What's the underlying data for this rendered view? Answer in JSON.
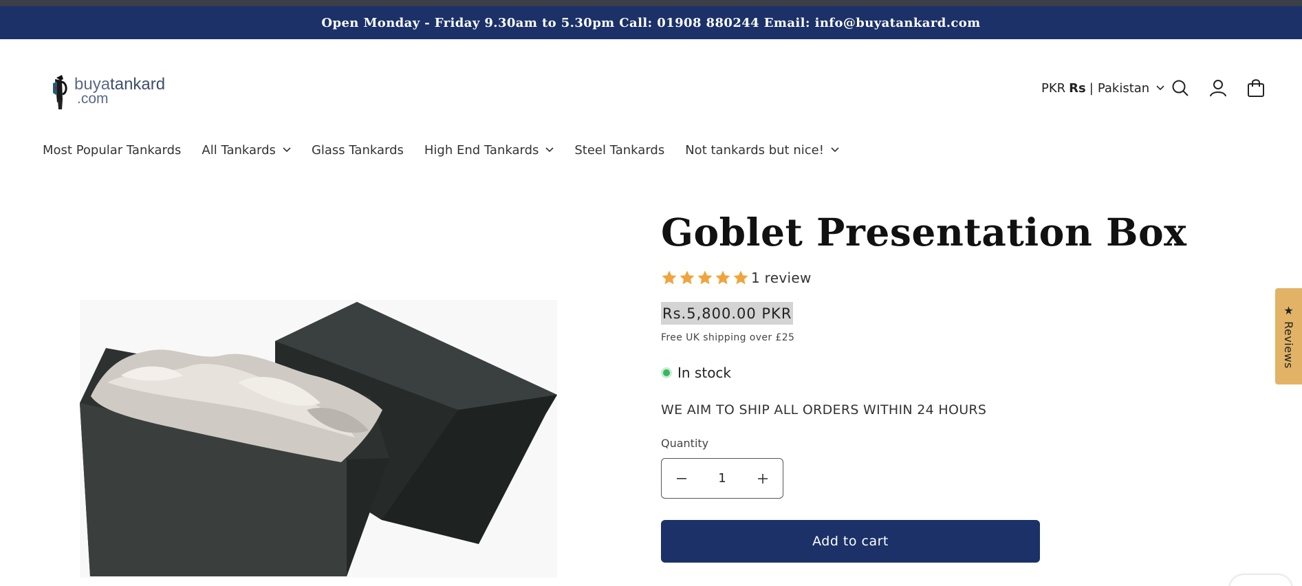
{
  "announcement": {
    "text": "Open Monday - Friday 9.30am to 5.30pm Call: 01908 880244 Email: info@buyatankard.com"
  },
  "logo": {
    "line1_a": "buya",
    "line1_b": "tankard",
    "line2": ".com"
  },
  "header": {
    "currency_code": "PKR",
    "currency_symbol": "Rs",
    "separator": "|",
    "country": "Pakistan"
  },
  "nav": {
    "items": [
      {
        "label": "Most Popular Tankards",
        "has_dropdown": false
      },
      {
        "label": "All Tankards",
        "has_dropdown": true
      },
      {
        "label": "Glass Tankards",
        "has_dropdown": false
      },
      {
        "label": "High End Tankards",
        "has_dropdown": true
      },
      {
        "label": "Steel Tankards",
        "has_dropdown": false
      },
      {
        "label": "Not tankards but nice!",
        "has_dropdown": true
      }
    ]
  },
  "product": {
    "title": "Goblet Presentation Box",
    "rating": 5,
    "rating_max": 5,
    "review_count": "1 review",
    "price": "Rs.5,800.00 PKR",
    "shipping_note": "Free UK shipping over £25",
    "stock_status": "In stock",
    "ship_message": "WE AIM TO SHIP ALL ORDERS WITHIN 24 HOURS",
    "quantity_label": "Quantity",
    "quantity": "1",
    "add_to_cart": "Add to cart"
  },
  "reviews_tab": {
    "label": "★ Reviews"
  },
  "colors": {
    "brand_navy": "#1b3168",
    "star": "#f0a43c",
    "stock_green": "#37b75a",
    "reviews_tab": "#e2b366"
  }
}
